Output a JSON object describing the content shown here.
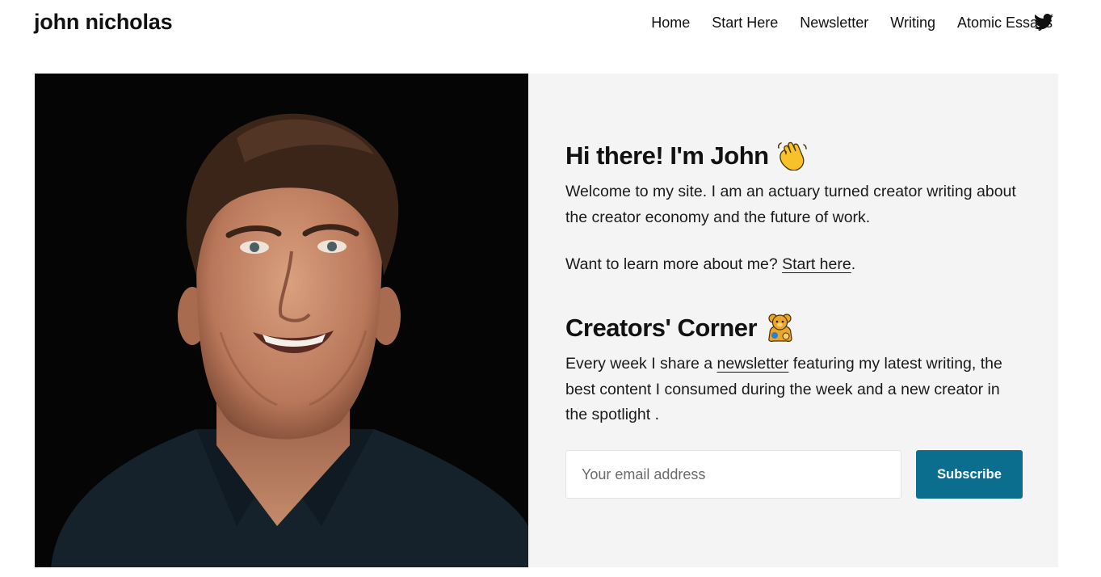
{
  "header": {
    "site_title": "john nicholas",
    "nav": [
      "Home",
      "Start Here",
      "Newsletter",
      "Writing",
      "Atomic Essays"
    ],
    "social_icon": "twitter-icon"
  },
  "intro": {
    "heading": "Hi there! I'm John",
    "heading_emoji": "waving-hand-icon",
    "body": "Welcome to my site. I am an actuary turned creator writing about the creator economy and the future of work.",
    "learn_prefix": "Want to learn more about me? ",
    "learn_link": "Start here",
    "learn_suffix": "."
  },
  "creators": {
    "heading": "Creators' Corner",
    "heading_emoji": "teddy-bear-icon",
    "body_prefix": "Every week I share a ",
    "body_link": "newsletter",
    "body_suffix": " featuring my latest writing, the best content I consumed during the week and a new creator in the spotlight ."
  },
  "form": {
    "email_placeholder": "Your email address",
    "subscribe_label": "Subscribe"
  },
  "colors": {
    "accent": "#0b6e8e",
    "panel_bg": "#f4f4f4",
    "photo_bg": "#040404"
  }
}
